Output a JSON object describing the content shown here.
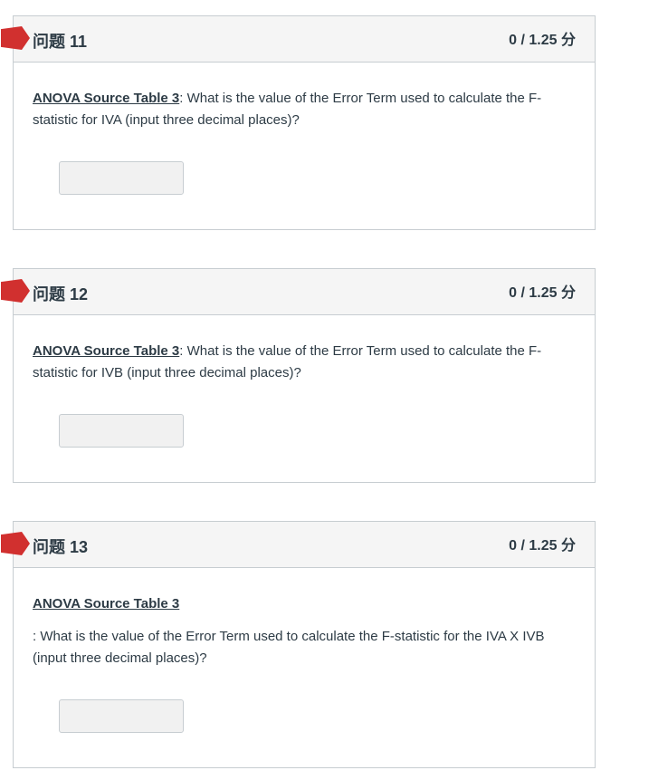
{
  "questions": [
    {
      "title": "问题 11",
      "points": "0 / 1.25 分",
      "link_text": "ANOVA Source Table 3",
      "text": ": What is the value of the Error Term used to calculate the F-statistic for IVA (input three decimal places)?",
      "answer_value": ""
    },
    {
      "title": "问题 12",
      "points": "0 / 1.25 分",
      "link_text": "ANOVA Source Table 3",
      "text": ": What is the value of the Error Term used to calculate the F-statistic for IVB (input three decimal places)?",
      "answer_value": ""
    },
    {
      "title": "问题 13",
      "points": "0 / 1.25 分",
      "link_text": "ANOVA Source Table 3",
      "text": ": What is the value of the Error Term used to calculate the F-statistic for the IVA X IVB (input three decimal places)?",
      "answer_value": ""
    }
  ],
  "colors": {
    "flag": "#d1302f",
    "header_bg": "#f5f5f5",
    "border": "#c7cdd1",
    "text": "#2d3b45",
    "input_bg": "#f1f1f1"
  }
}
